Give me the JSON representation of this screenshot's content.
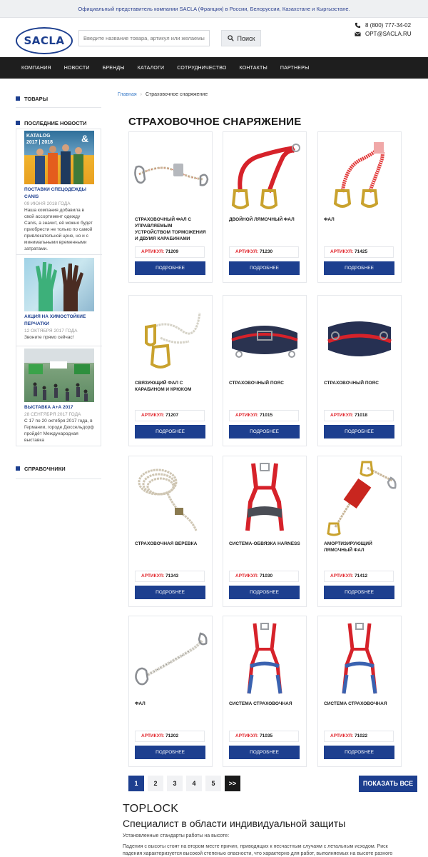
{
  "topbar": {
    "text": "Официальный представитель компании SACLA (Франция) в России, Белоруссии, Казахстане и Кыргызстане."
  },
  "header": {
    "logo": "SACLA",
    "search_placeholder": "Введите название товара, артикул или желаемые ха",
    "search_button": "Поиск",
    "phone": "8 (800) 777-34-02",
    "email": "OPT@SACLA.RU"
  },
  "nav": [
    "КОМПАНИЯ",
    "НОВОСТИ",
    "БРЕНДЫ",
    "КАТАЛОГИ",
    "СОТРУДНИЧЕСТВО",
    "КОНТАКТЫ",
    "ПАРТНЕРЫ"
  ],
  "sidebar": {
    "goods": "ТОВАРЫ",
    "news_heading": "ПОСЛЕДНИЕ НОВОСТИ",
    "directories": "СПРАВОЧНИКИ",
    "news": [
      {
        "image_text": "KATALOG 2017 | 2018",
        "title": "ПОСТАВКИ СПЕЦОДЕЖДЫ CANIS",
        "date": "09 ИЮНЯ 2018 ГОДА",
        "text": "Наша компания добавила в свой ассортимент одежду Canis, а значит, её можно будет приобрести не только по самой привлекательной цене, но и с минимальными временными затратами."
      },
      {
        "title": "АКЦИЯ НА ХИМОСТОЙКИЕ ПЕРЧАТКИ",
        "date": "12 ОКТЯБРЯ 2017 ГОДА",
        "text": "Звоните прямо сейчас!"
      },
      {
        "title": "ВЫСТАВКА А+А 2017",
        "date": "28 СЕНТЯБРЯ 2017 ГОДА",
        "text": "С 17 по 20 октября 2017 года, в Германии, городе Дюссельдорф пройдёт Международная выставка"
      }
    ]
  },
  "breadcrumb": {
    "home": "Главная",
    "separator": "›",
    "current": "Страховочное снаряжение"
  },
  "page_title": "СТРАХОВОЧНОЕ СНАРЯЖЕНИЕ",
  "article_label": "АРТИКУЛ:",
  "more_label": "ПОДРОБНЕЕ",
  "products": [
    {
      "name": "СТРАХОВОЧНЫЙ ФАЛ С УПРАВЛЯЕМЫМ УСТРОЙСТВОМ ТОРМОЖЕНИЯ И ДВУМЯ КАРАБИНАМИ",
      "article": "71209",
      "icon": "lanyard-rope-icon"
    },
    {
      "name": "ДВОЙНОЙ ЛЯМОЧНЫЙ ФАЛ",
      "article": "71230",
      "icon": "double-lanyard-icon"
    },
    {
      "name": "ФАЛ",
      "article": "71425",
      "icon": "elastic-lanyard-icon"
    },
    {
      "name": "СВЯЗУЮЩИЙ ФАЛ С КАРАБИНОМ И КРЮКОМ",
      "article": "71207",
      "icon": "rope-hook-icon"
    },
    {
      "name": "СТРАХОВОЧНЫЙ ПОЯС",
      "article": "71015",
      "icon": "belt-icon"
    },
    {
      "name": "СТРАХОВОЧНЫЙ ПОЯС",
      "article": "71018",
      "icon": "belt-icon"
    },
    {
      "name": "СТРАХОВОЧНАЯ ВЕРЕВКА",
      "article": "71343",
      "icon": "coiled-rope-icon"
    },
    {
      "name": "СИСТЕМА-ОБВЯЗКА HARNESS",
      "article": "71030",
      "icon": "harness-icon"
    },
    {
      "name": "АМОРТИЗИРУЮЩИЙ ЛЯМОЧНЫЙ ФАЛ",
      "article": "71412",
      "icon": "absorber-lanyard-icon"
    },
    {
      "name": "ФАЛ",
      "article": "71202",
      "icon": "rope-lanyard-icon"
    },
    {
      "name": "СИСТЕМА СТРАХОВОЧНАЯ",
      "article": "71035",
      "icon": "harness-blue-icon"
    },
    {
      "name": "СИСТЕМА СТРАХОВОЧНАЯ",
      "article": "71022",
      "icon": "harness-blue-icon"
    }
  ],
  "pagination": {
    "pages": [
      "1",
      "2",
      "3",
      "4",
      "5"
    ],
    "next": ">>",
    "current": "1",
    "show_all": "ПОКАЗАТЬ ВСЕ"
  },
  "brand": {
    "title": "TOPLOCK",
    "subtitle": "Специалист в области индивидуальной защиты",
    "p1": "Установленные стандарты работы на высоте:",
    "p2": "Падения с высоты стоят на втором месте причин, приводящих к несчастным случаям с летальным исходом. Риск падения характеризуется высокой степенью опасности, что характерно для работ, выполняемых на высоте разного"
  },
  "colors": {
    "brand_blue": "#1d3f8f",
    "nav_bg": "#1e1e1e",
    "accent_red": "#e0262d"
  }
}
